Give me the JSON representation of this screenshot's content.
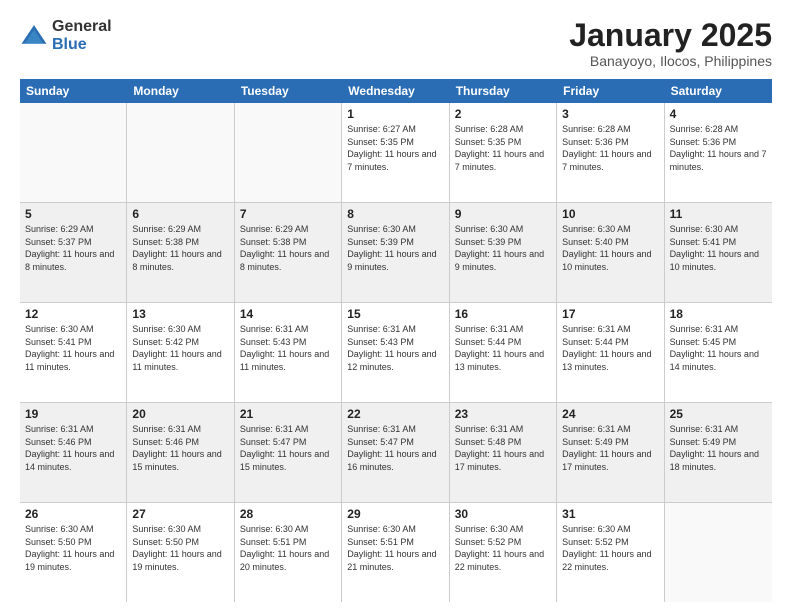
{
  "logo": {
    "general": "General",
    "blue": "Blue"
  },
  "title": "January 2025",
  "location": "Banayoyo, Ilocos, Philippines",
  "days": [
    "Sunday",
    "Monday",
    "Tuesday",
    "Wednesday",
    "Thursday",
    "Friday",
    "Saturday"
  ],
  "weeks": [
    [
      {
        "day": "",
        "sunrise": "",
        "sunset": "",
        "daylight": ""
      },
      {
        "day": "",
        "sunrise": "",
        "sunset": "",
        "daylight": ""
      },
      {
        "day": "",
        "sunrise": "",
        "sunset": "",
        "daylight": ""
      },
      {
        "day": "1",
        "sunrise": "Sunrise: 6:27 AM",
        "sunset": "Sunset: 5:35 PM",
        "daylight": "Daylight: 11 hours and 7 minutes."
      },
      {
        "day": "2",
        "sunrise": "Sunrise: 6:28 AM",
        "sunset": "Sunset: 5:35 PM",
        "daylight": "Daylight: 11 hours and 7 minutes."
      },
      {
        "day": "3",
        "sunrise": "Sunrise: 6:28 AM",
        "sunset": "Sunset: 5:36 PM",
        "daylight": "Daylight: 11 hours and 7 minutes."
      },
      {
        "day": "4",
        "sunrise": "Sunrise: 6:28 AM",
        "sunset": "Sunset: 5:36 PM",
        "daylight": "Daylight: 11 hours and 7 minutes."
      }
    ],
    [
      {
        "day": "5",
        "sunrise": "Sunrise: 6:29 AM",
        "sunset": "Sunset: 5:37 PM",
        "daylight": "Daylight: 11 hours and 8 minutes."
      },
      {
        "day": "6",
        "sunrise": "Sunrise: 6:29 AM",
        "sunset": "Sunset: 5:38 PM",
        "daylight": "Daylight: 11 hours and 8 minutes."
      },
      {
        "day": "7",
        "sunrise": "Sunrise: 6:29 AM",
        "sunset": "Sunset: 5:38 PM",
        "daylight": "Daylight: 11 hours and 8 minutes."
      },
      {
        "day": "8",
        "sunrise": "Sunrise: 6:30 AM",
        "sunset": "Sunset: 5:39 PM",
        "daylight": "Daylight: 11 hours and 9 minutes."
      },
      {
        "day": "9",
        "sunrise": "Sunrise: 6:30 AM",
        "sunset": "Sunset: 5:39 PM",
        "daylight": "Daylight: 11 hours and 9 minutes."
      },
      {
        "day": "10",
        "sunrise": "Sunrise: 6:30 AM",
        "sunset": "Sunset: 5:40 PM",
        "daylight": "Daylight: 11 hours and 10 minutes."
      },
      {
        "day": "11",
        "sunrise": "Sunrise: 6:30 AM",
        "sunset": "Sunset: 5:41 PM",
        "daylight": "Daylight: 11 hours and 10 minutes."
      }
    ],
    [
      {
        "day": "12",
        "sunrise": "Sunrise: 6:30 AM",
        "sunset": "Sunset: 5:41 PM",
        "daylight": "Daylight: 11 hours and 11 minutes."
      },
      {
        "day": "13",
        "sunrise": "Sunrise: 6:30 AM",
        "sunset": "Sunset: 5:42 PM",
        "daylight": "Daylight: 11 hours and 11 minutes."
      },
      {
        "day": "14",
        "sunrise": "Sunrise: 6:31 AM",
        "sunset": "Sunset: 5:43 PM",
        "daylight": "Daylight: 11 hours and 11 minutes."
      },
      {
        "day": "15",
        "sunrise": "Sunrise: 6:31 AM",
        "sunset": "Sunset: 5:43 PM",
        "daylight": "Daylight: 11 hours and 12 minutes."
      },
      {
        "day": "16",
        "sunrise": "Sunrise: 6:31 AM",
        "sunset": "Sunset: 5:44 PM",
        "daylight": "Daylight: 11 hours and 13 minutes."
      },
      {
        "day": "17",
        "sunrise": "Sunrise: 6:31 AM",
        "sunset": "Sunset: 5:44 PM",
        "daylight": "Daylight: 11 hours and 13 minutes."
      },
      {
        "day": "18",
        "sunrise": "Sunrise: 6:31 AM",
        "sunset": "Sunset: 5:45 PM",
        "daylight": "Daylight: 11 hours and 14 minutes."
      }
    ],
    [
      {
        "day": "19",
        "sunrise": "Sunrise: 6:31 AM",
        "sunset": "Sunset: 5:46 PM",
        "daylight": "Daylight: 11 hours and 14 minutes."
      },
      {
        "day": "20",
        "sunrise": "Sunrise: 6:31 AM",
        "sunset": "Sunset: 5:46 PM",
        "daylight": "Daylight: 11 hours and 15 minutes."
      },
      {
        "day": "21",
        "sunrise": "Sunrise: 6:31 AM",
        "sunset": "Sunset: 5:47 PM",
        "daylight": "Daylight: 11 hours and 15 minutes."
      },
      {
        "day": "22",
        "sunrise": "Sunrise: 6:31 AM",
        "sunset": "Sunset: 5:47 PM",
        "daylight": "Daylight: 11 hours and 16 minutes."
      },
      {
        "day": "23",
        "sunrise": "Sunrise: 6:31 AM",
        "sunset": "Sunset: 5:48 PM",
        "daylight": "Daylight: 11 hours and 17 minutes."
      },
      {
        "day": "24",
        "sunrise": "Sunrise: 6:31 AM",
        "sunset": "Sunset: 5:49 PM",
        "daylight": "Daylight: 11 hours and 17 minutes."
      },
      {
        "day": "25",
        "sunrise": "Sunrise: 6:31 AM",
        "sunset": "Sunset: 5:49 PM",
        "daylight": "Daylight: 11 hours and 18 minutes."
      }
    ],
    [
      {
        "day": "26",
        "sunrise": "Sunrise: 6:30 AM",
        "sunset": "Sunset: 5:50 PM",
        "daylight": "Daylight: 11 hours and 19 minutes."
      },
      {
        "day": "27",
        "sunrise": "Sunrise: 6:30 AM",
        "sunset": "Sunset: 5:50 PM",
        "daylight": "Daylight: 11 hours and 19 minutes."
      },
      {
        "day": "28",
        "sunrise": "Sunrise: 6:30 AM",
        "sunset": "Sunset: 5:51 PM",
        "daylight": "Daylight: 11 hours and 20 minutes."
      },
      {
        "day": "29",
        "sunrise": "Sunrise: 6:30 AM",
        "sunset": "Sunset: 5:51 PM",
        "daylight": "Daylight: 11 hours and 21 minutes."
      },
      {
        "day": "30",
        "sunrise": "Sunrise: 6:30 AM",
        "sunset": "Sunset: 5:52 PM",
        "daylight": "Daylight: 11 hours and 22 minutes."
      },
      {
        "day": "31",
        "sunrise": "Sunrise: 6:30 AM",
        "sunset": "Sunset: 5:52 PM",
        "daylight": "Daylight: 11 hours and 22 minutes."
      },
      {
        "day": "",
        "sunrise": "",
        "sunset": "",
        "daylight": ""
      }
    ]
  ]
}
